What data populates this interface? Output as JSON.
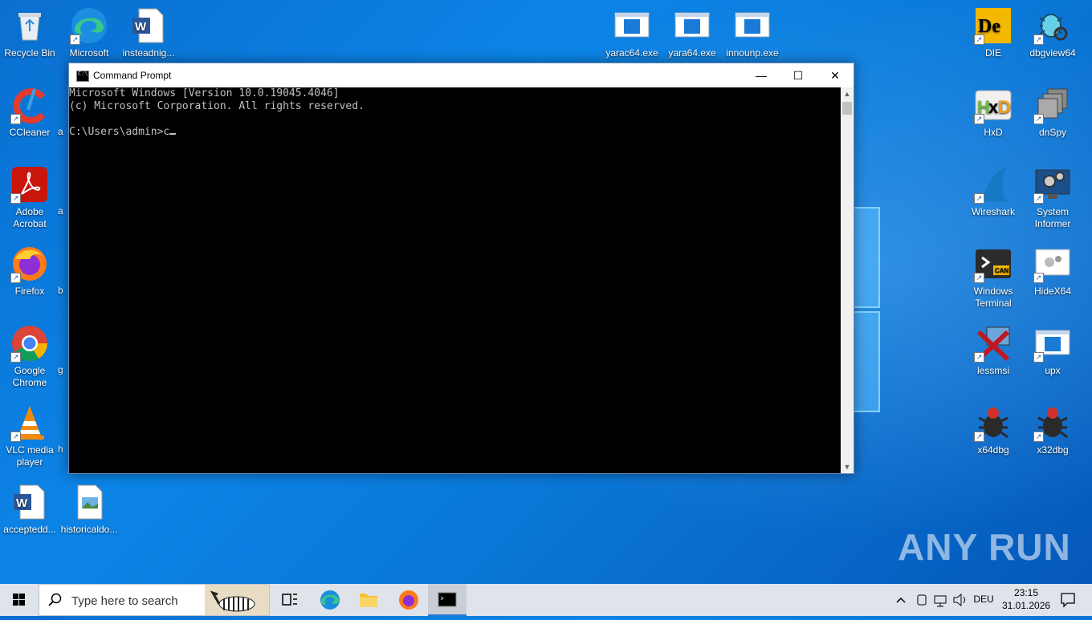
{
  "desktop": {
    "left_icons": [
      {
        "label": "Recycle Bin"
      },
      {
        "label": "CCleaner"
      },
      {
        "label": "Adobe Acrobat"
      },
      {
        "label": "Firefox"
      },
      {
        "label": "Google Chrome"
      },
      {
        "label": "VLC media player"
      },
      {
        "label": "acceptedd..."
      }
    ],
    "second_col": [
      {
        "label": "Microsoft Edge"
      },
      {
        "label": "historicaldo..."
      }
    ],
    "partial_labels": [
      "a",
      "a",
      "b",
      "g",
      "h"
    ],
    "top_icons": [
      {
        "label": "insteadnig..."
      },
      {
        "label": "yarac64.exe"
      },
      {
        "label": "yara64.exe"
      },
      {
        "label": "innounp.exe"
      }
    ],
    "right_icons": [
      {
        "label": "DIE"
      },
      {
        "label": "dbgview64"
      },
      {
        "label": "HxD"
      },
      {
        "label": "dnSpy"
      },
      {
        "label": "Wireshark"
      },
      {
        "label": "System Informer"
      },
      {
        "label": "Windows Terminal"
      },
      {
        "label": "HideX64"
      },
      {
        "label": "lessmsi"
      },
      {
        "label": "upx"
      },
      {
        "label": "x64dbg"
      },
      {
        "label": "x32dbg"
      }
    ]
  },
  "cmd_window": {
    "title": "Command Prompt",
    "minimize": "—",
    "maximize": "☐",
    "close": "✕",
    "lines": [
      "Microsoft Windows [Version 10.0.19045.4046]",
      "(c) Microsoft Corporation. All rights reserved.",
      "",
      "C:\\Users\\admin>c"
    ]
  },
  "taskbar": {
    "search_placeholder": "Type here to search",
    "language": "DEU",
    "time": "23:15",
    "date": "31.01.2026"
  },
  "watermark": "ANY RUN"
}
